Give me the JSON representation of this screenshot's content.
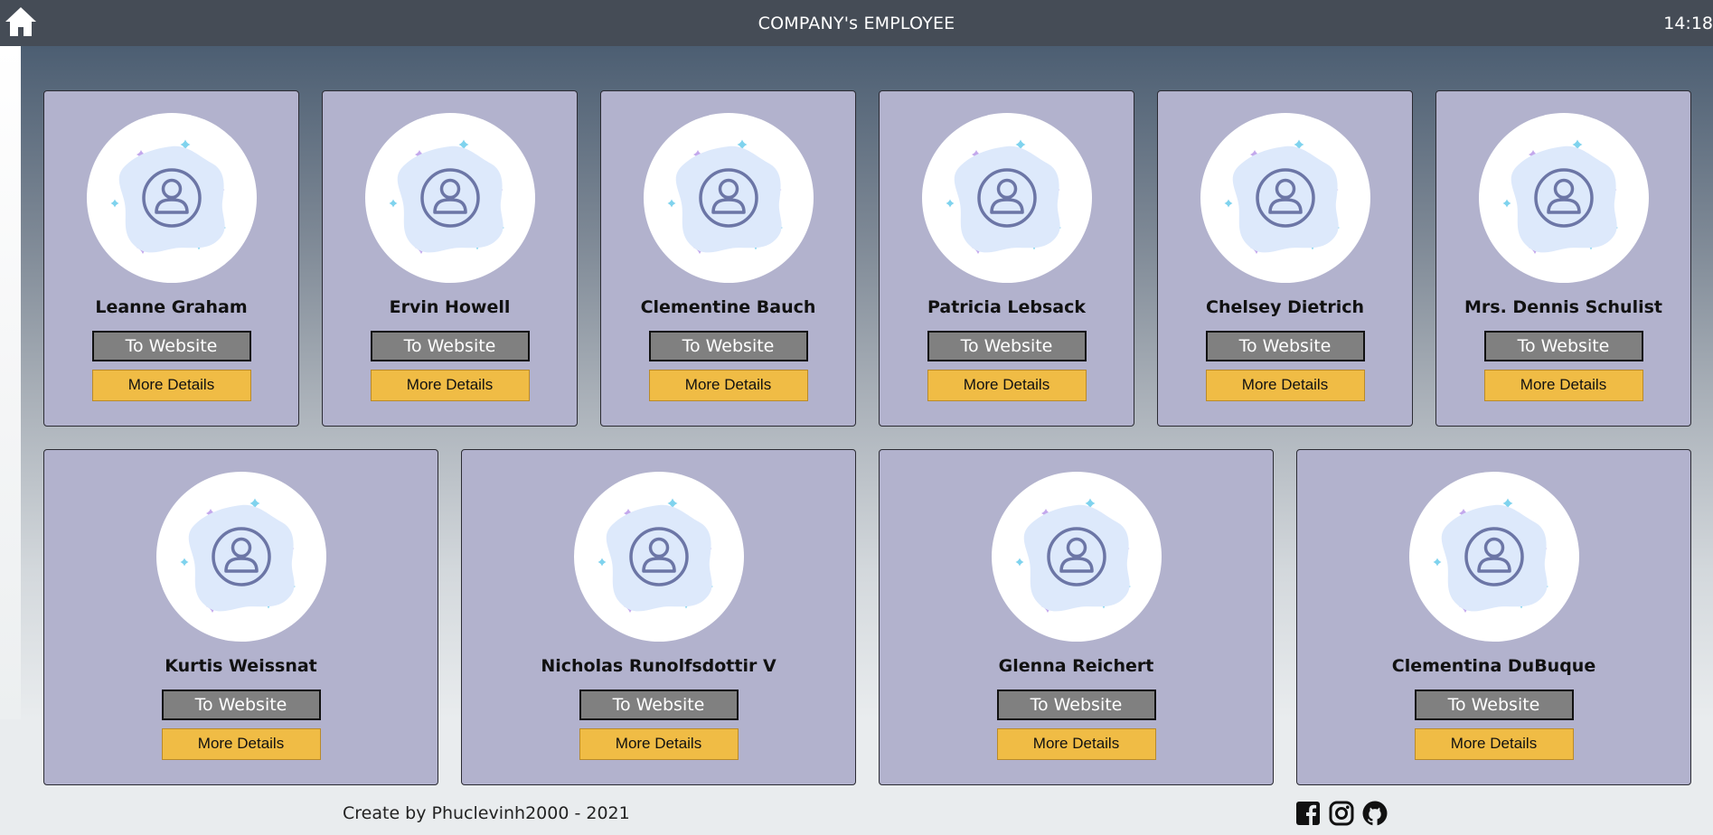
{
  "header": {
    "title": "COMPANY's EMPLOYEE",
    "time": "14:18",
    "home_icon": "home-icon"
  },
  "employees": [
    {
      "name": "Leanne Graham",
      "website_label": "To Website",
      "details_label": "More Details"
    },
    {
      "name": "Ervin Howell",
      "website_label": "To Website",
      "details_label": "More Details"
    },
    {
      "name": "Clementine Bauch",
      "website_label": "To Website",
      "details_label": "More Details"
    },
    {
      "name": "Patricia Lebsack",
      "website_label": "To Website",
      "details_label": "More Details"
    },
    {
      "name": "Chelsey Dietrich",
      "website_label": "To Website",
      "details_label": "More Details"
    },
    {
      "name": "Mrs. Dennis Schulist",
      "website_label": "To Website",
      "details_label": "More Details"
    },
    {
      "name": "Kurtis Weissnat",
      "website_label": "To Website",
      "details_label": "More Details"
    },
    {
      "name": "Nicholas Runolfsdottir V",
      "website_label": "To Website",
      "details_label": "More Details"
    },
    {
      "name": "Glenna Reichert",
      "website_label": "To Website",
      "details_label": "More Details"
    },
    {
      "name": "Clementina DuBuque",
      "website_label": "To Website",
      "details_label": "More Details"
    }
  ],
  "footer": {
    "credit": "Create by Phuclevinh2000 - 2021",
    "social_icons": [
      "facebook-icon",
      "instagram-icon",
      "github-icon"
    ]
  },
  "colors": {
    "header_bg": "#454c56",
    "card_bg": "#b2b2cd",
    "website_button": "#808080",
    "details_button": "#f0bc45"
  }
}
